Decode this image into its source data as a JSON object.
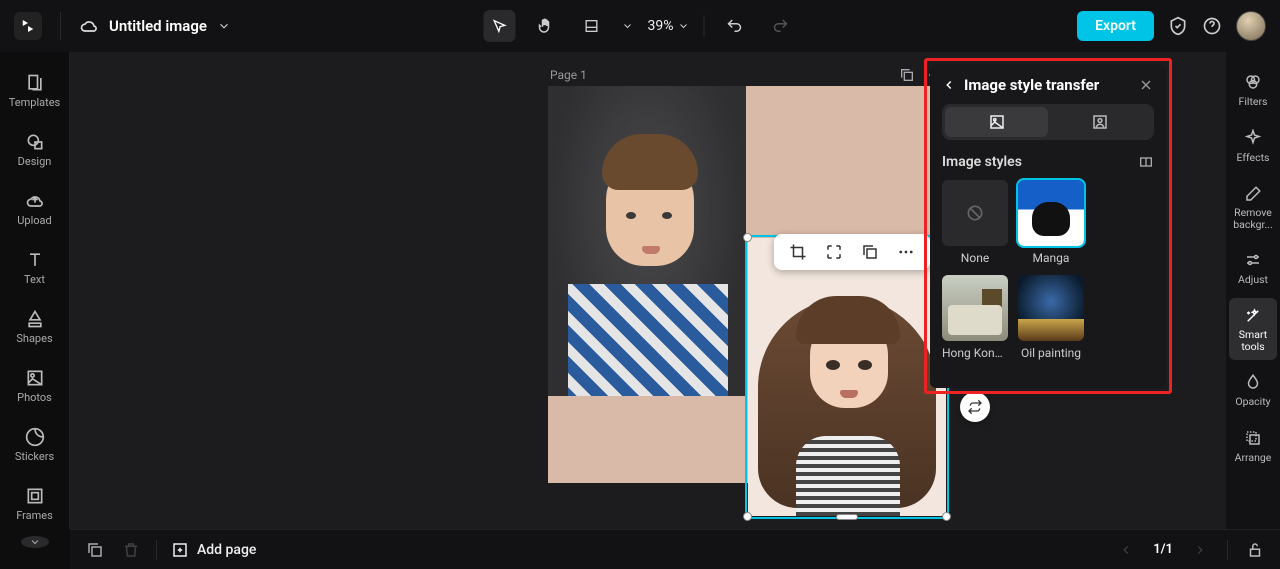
{
  "header": {
    "title": "Untitled image",
    "zoom": "39%",
    "export_label": "Export"
  },
  "left_sidebar": {
    "items": [
      "Templates",
      "Design",
      "Upload",
      "Text",
      "Shapes",
      "Photos",
      "Stickers",
      "Frames"
    ]
  },
  "canvas": {
    "page_label": "Page 1"
  },
  "style_panel": {
    "title": "Image style transfer",
    "section_label": "Image styles",
    "styles": [
      {
        "label": "None"
      },
      {
        "label": "Manga"
      },
      {
        "label": "Hong Kong ..."
      },
      {
        "label": "Oil painting"
      }
    ]
  },
  "right_sidebar": {
    "items": [
      "Filters",
      "Effects",
      "Remove backgr...",
      "Adjust",
      "Smart tools",
      "Opacity",
      "Arrange"
    ]
  },
  "bottombar": {
    "add_page_label": "Add page",
    "pager": "1/1"
  }
}
